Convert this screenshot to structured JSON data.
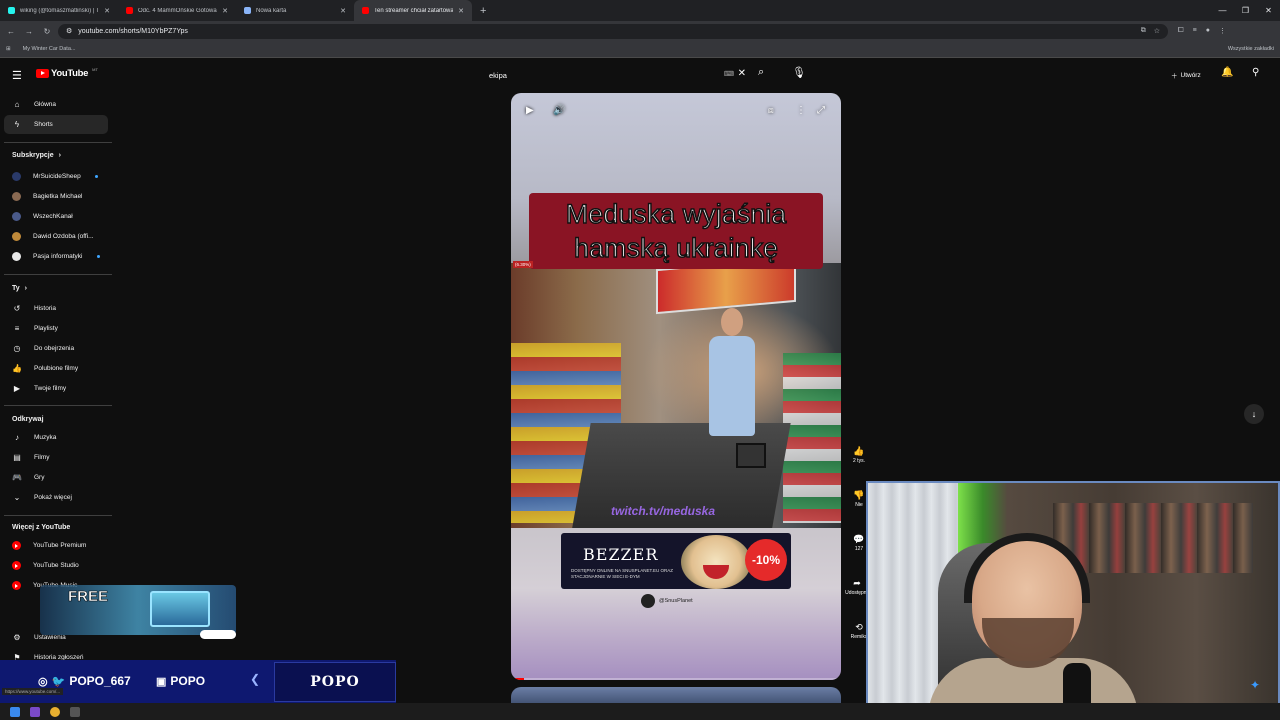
{
  "browser": {
    "tabs": [
      {
        "title": "wiking (@tomaszmatlinski) | Tik",
        "favicon_color": "#25f4ee"
      },
      {
        "title": "Odc. 4 MammOńskie Gotowan",
        "favicon_color": "#ff0000"
      },
      {
        "title": "Nowa karta",
        "favicon_color": "#8ab4f8"
      },
      {
        "title": "Ten streamer chciał zatartowa",
        "favicon_color": "#ff0000",
        "active": true
      }
    ],
    "new_tab": "+",
    "url": "youtube.com/shorts/M10YbPZ7Yps",
    "bookmarks_bar": {
      "apps_icon": "apps-grid-icon",
      "item": "My Winter Car Data...",
      "all_bookmarks": "Wszystkie zakładki"
    }
  },
  "masthead": {
    "logo_text": "YouTube",
    "country_code": "MT",
    "search_value": "ekipa",
    "create_label": "Utwórz"
  },
  "sidebar": {
    "main": [
      {
        "label": "Główna",
        "icon": "home-icon"
      },
      {
        "label": "Shorts",
        "icon": "shorts-icon",
        "active": true
      }
    ],
    "subscriptions_header": "Subskrypcje",
    "subscriptions": [
      {
        "label": "MrSuicideSheep",
        "color": "#2a3a6a",
        "live": true
      },
      {
        "label": "Bagietka Michael",
        "color": "#8a6a52",
        "live": false
      },
      {
        "label": "WszechKanał",
        "color": "#4a5a8a",
        "live": false
      },
      {
        "label": "Dawid Ozdoba (offi...",
        "color": "#c08a3a",
        "live": false
      },
      {
        "label": "Pasja informatyki",
        "color": "#e8e8e8",
        "live": true
      }
    ],
    "you_header": "Ty",
    "you": [
      {
        "label": "Historia",
        "icon": "history-icon"
      },
      {
        "label": "Playlisty",
        "icon": "playlist-icon"
      },
      {
        "label": "Do obejrzenia",
        "icon": "watch-later-icon"
      },
      {
        "label": "Polubione filmy",
        "icon": "thumbs-up-icon"
      },
      {
        "label": "Twoje filmy",
        "icon": "your-videos-icon"
      }
    ],
    "explore_header": "Odkrywaj",
    "explore": [
      {
        "label": "Muzyka",
        "icon": "music-icon"
      },
      {
        "label": "Filmy",
        "icon": "film-icon"
      },
      {
        "label": "Gry",
        "icon": "gaming-icon"
      },
      {
        "label": "Pokaż więcej",
        "icon": "chevron-down-icon"
      }
    ],
    "more_header": "Więcej z YouTube",
    "more": [
      {
        "label": "YouTube Premium"
      },
      {
        "label": "YouTube Studio"
      },
      {
        "label": "YouTube Music"
      }
    ],
    "settings_label": "Ustawienia",
    "report_label": "Historia zgłoszeń"
  },
  "short": {
    "caption": "Meduska wyjaśnia hamską ukrainkę",
    "percent_tag": "(6.30%)",
    "twitch_tag": "twitch.tv/meduska",
    "ad": {
      "brand": "BEZZER",
      "subtitle": "DOSTĘPNY ONLINE NA SNUSPLANET.EU ORAZ STACJONARNIE W SIECI E-DYM",
      "badge": "-10%",
      "sponsor": "@SnusPlanet"
    },
    "progress_fraction": 0.04
  },
  "actions": {
    "like_count": "2 tys.",
    "dislike_label": "Nie",
    "comments_count": "127",
    "share_label": "Udostępnij",
    "remix_label": "Remiks"
  },
  "overlay": {
    "free_title": "FREE",
    "social_handle": "POPO_667",
    "youtube_name": "POPO",
    "brand": "POPO"
  },
  "status_url": "https://www.youtube.com/..."
}
